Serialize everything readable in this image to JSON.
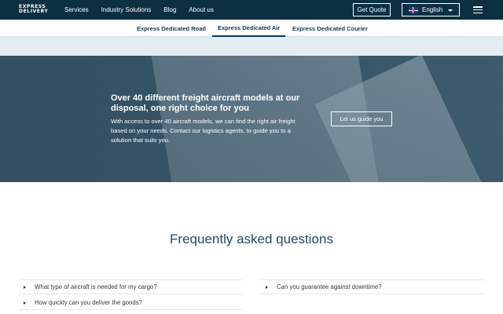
{
  "brand": {
    "line1": "EXPRESS",
    "line2": "DELIVERY"
  },
  "nav": {
    "links": [
      "Services",
      "Industry Solutions",
      "Blog",
      "About us"
    ],
    "quote_label": "Get Quote",
    "language": "English"
  },
  "subnav": {
    "tabs": [
      "Express Dedicated Road",
      "Express Dedicated Air",
      "Express Dedicated Courier"
    ],
    "active": "Express Dedicated Air"
  },
  "hero": {
    "title": "Over 40 different freight aircraft models at our disposal, one right choice for you",
    "text": "With access to over 40 aircraft models, we can find the right air freight based on your needs. Contact our logistics agents, to guide you to a solution that suits you.",
    "button": "Let us guide you"
  },
  "faq": {
    "title": "Frequently asked questions",
    "items": [
      "What type of aircraft is needed for my cargo?",
      "How quickly can you deliver the goods?",
      "Can you guarantee against downtime?"
    ]
  },
  "colors": {
    "nav_bg": "#0d2f42",
    "accent": "#1f4a60",
    "hero_bg": "#3d5b6e"
  }
}
